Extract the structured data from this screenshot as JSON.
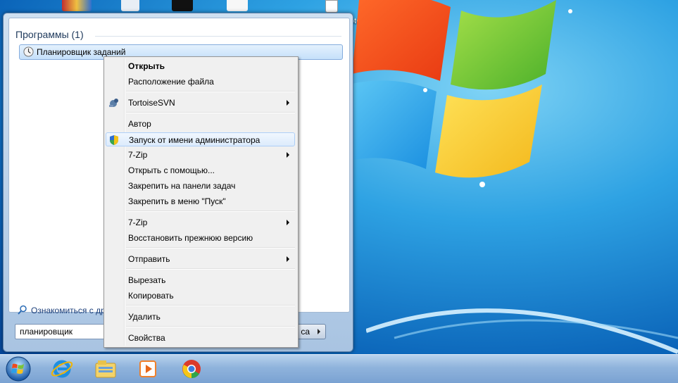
{
  "desktop": {
    "notes_label": "otes"
  },
  "start_menu": {
    "programs_header": "Программы (1)",
    "result_item": "Планировщик заданий",
    "see_more": "Ознакомиться с дру",
    "search_value": "планировщик",
    "shutdown_partial": "са"
  },
  "context_menu": {
    "items": [
      {
        "label": "Открыть"
      },
      {
        "label": "Расположение файла"
      },
      {
        "label": "TortoiseSVN"
      },
      {
        "label": "Автор"
      },
      {
        "label": "Запуск от имени администратора"
      },
      {
        "label": "7-Zip"
      },
      {
        "label": "Открыть с помощью..."
      },
      {
        "label": "Закрепить на панели задач"
      },
      {
        "label": "Закрепить в меню \"Пуск\""
      },
      {
        "label": "7-Zip"
      },
      {
        "label": "Восстановить прежнюю версию"
      },
      {
        "label": "Отправить"
      },
      {
        "label": "Вырезать"
      },
      {
        "label": "Копировать"
      },
      {
        "label": "Удалить"
      },
      {
        "label": "Свойства"
      }
    ]
  },
  "taskbar": {
    "icons": [
      "start-orb",
      "internet-explorer-icon",
      "windows-explorer-icon",
      "media-player-icon",
      "chrome-icon"
    ]
  },
  "colors": {
    "accent": "#2ea2e3",
    "highlight": "#dcebfc"
  }
}
